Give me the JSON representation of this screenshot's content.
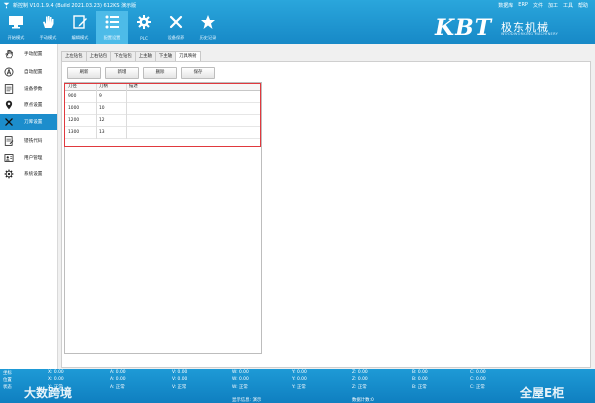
{
  "app": {
    "title": "新控制 V10.1.9.4 (Build 2021.03.23) 612KS 演示版",
    "menu": [
      "数据库",
      "ERP",
      "文件",
      "加工",
      "工具",
      "帮助"
    ]
  },
  "toolbar": [
    {
      "label": "开始模式",
      "icon": "monitor-icon"
    },
    {
      "label": "手动模式",
      "icon": "hand-icon"
    },
    {
      "label": "编辑模式",
      "icon": "edit-icon"
    },
    {
      "label": "配置设置",
      "icon": "list-icon",
      "active": true
    },
    {
      "label": "PLC",
      "icon": "gear-icon"
    },
    {
      "label": "设备保养",
      "icon": "tools-icon"
    },
    {
      "label": "历史记录",
      "icon": "star-icon"
    }
  ],
  "brand": {
    "logo": "KBT",
    "chinese": "极东机械",
    "english": "WOODWORKING MACHINERY"
  },
  "sidebar": [
    {
      "label": "手动配置",
      "icon": "hand-icon"
    },
    {
      "label": "自动配置",
      "icon": "auto-icon"
    },
    {
      "label": "设备参数",
      "icon": "params-icon"
    },
    {
      "label": "原点设置",
      "icon": "location-icon"
    },
    {
      "label": "刀库设置",
      "icon": "tools-icon",
      "active": true
    },
    {
      "label": "镂铣代码",
      "icon": "code-icon"
    },
    {
      "label": "用户管理",
      "icon": "user-icon"
    },
    {
      "label": "系统设置",
      "icon": "gear-icon"
    }
  ],
  "tabs": [
    "上左钻包",
    "上右钻包",
    "下左钻包",
    "上主轴",
    "下主轴",
    "刀具映射"
  ],
  "buttons": [
    "刷新",
    "新增",
    "删除",
    "保存"
  ],
  "table": {
    "headers": [
      "刀径",
      "刀柄",
      "描述"
    ],
    "rows": [
      [
        "900",
        "9",
        ""
      ],
      [
        "1000",
        "10",
        ""
      ],
      [
        "1200",
        "12",
        ""
      ],
      [
        "1300",
        "13",
        ""
      ]
    ]
  },
  "status": {
    "rows": [
      [
        "坐标",
        "X: 0.00",
        "A: 0.00",
        "V: 0.00",
        "W: 0.00",
        "Y: 0.00",
        "Z: 0.00",
        "B: 0.00",
        "C: 0.00"
      ],
      [
        "位置",
        "X: 0.00",
        "A: 0.00",
        "V: 0.00",
        "W: 0.00",
        "Y: 0.00",
        "Z: 0.00",
        "B: 0.00",
        "C: 0.00"
      ],
      [
        "状态",
        "X: 正常",
        "A: 正常",
        "V: 正常",
        "W: 正常",
        "Y: 正常",
        "Z: 正常",
        "B: 正常",
        "C: 正常"
      ]
    ],
    "footer_left": "显示信息: 演示",
    "footer_right": "数据计数:0"
  },
  "watermarks": {
    "left": "大数跨境",
    "right": "全屋E柜"
  },
  "colors": {
    "header": "#1789c7",
    "active": "#1c8dcc",
    "highlight": "#e0393e"
  }
}
